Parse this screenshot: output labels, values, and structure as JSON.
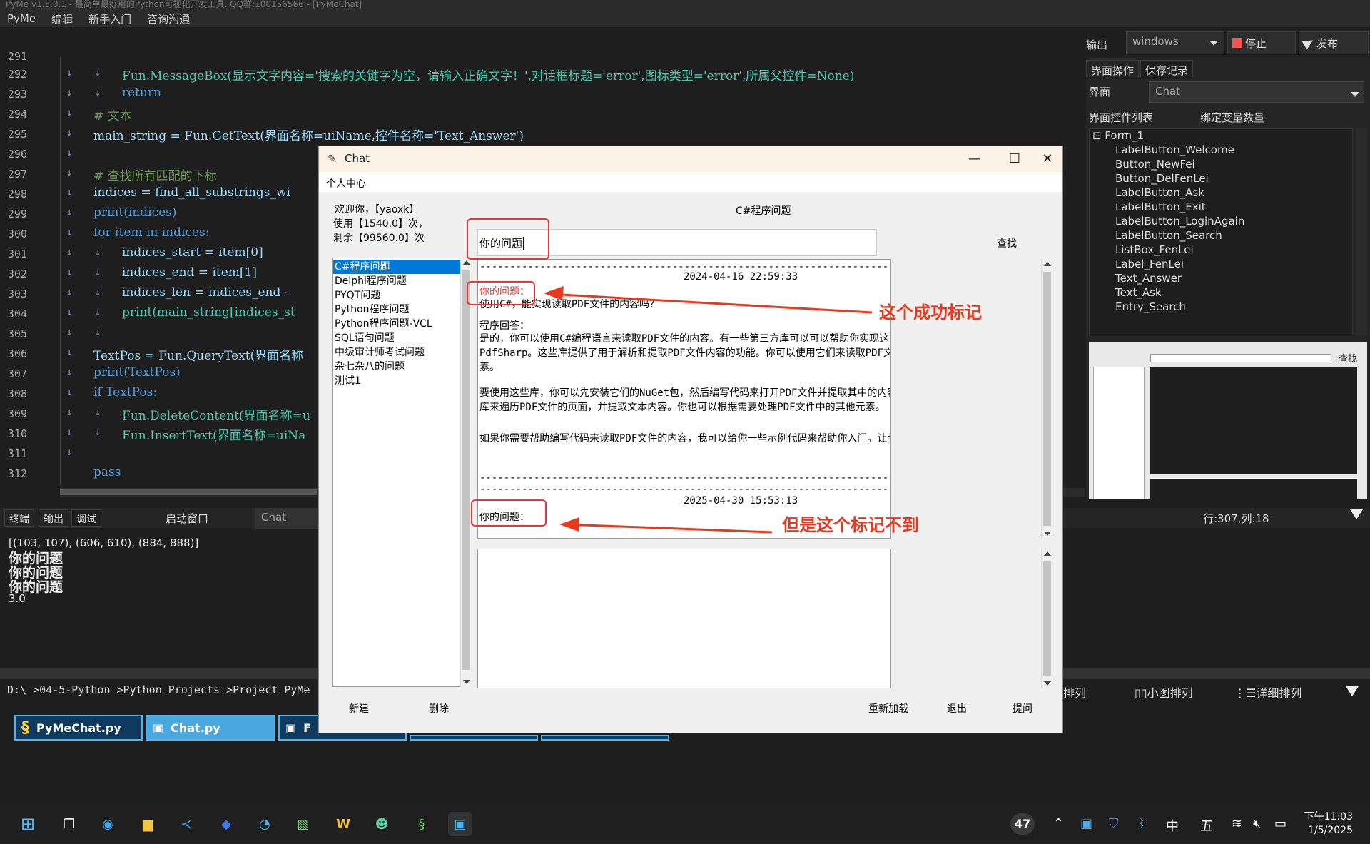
{
  "app": {
    "title": "PyMe v1.5.0.1 - 最简单最好用的Python可视化开发工具. QQ群:100156566 - [PyMeChat]"
  },
  "menu": [
    "PyMe",
    "编辑",
    "新手入门",
    "咨询沟通"
  ],
  "toolbar": {
    "output_label": "输出",
    "platform": "windows",
    "stop": "停止",
    "publish": "发布"
  },
  "code": {
    "lines": [
      {
        "n": "291",
        "text": ""
      },
      {
        "n": "292",
        "text": "Fun.MessageBox(显示文字内容='搜索的关键字为空，请输入正确文字！',对话框标题='error',图标类型='error',所属父控件=None)"
      },
      {
        "n": "293",
        "text": "return"
      },
      {
        "n": "294",
        "text": "# 文本"
      },
      {
        "n": "295",
        "text": "main_string = Fun.GetText(界面名称=uiName,控件名称='Text_Answer')"
      },
      {
        "n": "296",
        "text": ""
      },
      {
        "n": "297",
        "text": "# 查找所有匹配的下标"
      },
      {
        "n": "298",
        "text": "indices = find_all_substrings_wi"
      },
      {
        "n": "299",
        "text": "print(indices)"
      },
      {
        "n": "300",
        "text": "for item in indices:"
      },
      {
        "n": "301",
        "text": "indices_start = item[0]"
      },
      {
        "n": "302",
        "text": "indices_end = item[1]"
      },
      {
        "n": "303",
        "text": "indices_len = indices_end -"
      },
      {
        "n": "304",
        "text": "print(main_string[indices_st"
      },
      {
        "n": "305",
        "text": ""
      },
      {
        "n": "306",
        "text": "TextPos = Fun.QueryText(界面名称"
      },
      {
        "n": "307",
        "text": "print(TextPos)"
      },
      {
        "n": "308",
        "text": "if TextPos:"
      },
      {
        "n": "309",
        "text": "Fun.DeleteContent(界面名称=u"
      },
      {
        "n": "310",
        "text": "Fun.InsertText(界面名称=uiNa"
      },
      {
        "n": "311",
        "text": ""
      },
      {
        "n": "312",
        "text": "pass"
      }
    ]
  },
  "right_panel": {
    "tabs": [
      "界面操作",
      "保存记录"
    ],
    "ui_label": "界面",
    "ui_value": "Chat",
    "list_label": "界面控件列表",
    "bind_label": "绑定变量数量",
    "tree_root": "Form_1",
    "controls": [
      "LabelButton_Welcome",
      "Button_NewFei",
      "Button_DelFenLei",
      "LabelButton_Ask",
      "LabelButton_Exit",
      "LabelButton_LoginAgain",
      "LabelButton_Search",
      "ListBox_FenLei",
      "Label_FenLei",
      "Text_Answer",
      "Text_Ask",
      "Entry_Search"
    ],
    "preview_search": "查找"
  },
  "bottom": {
    "tabs": [
      "终端",
      "输出",
      "调试"
    ],
    "start_window": "启动窗口",
    "start_value": "Chat",
    "position": "行:307,列:18",
    "console": [
      "[(103, 107), (606, 610), (884, 888)]",
      "你的问题",
      "你的问题",
      "你的问题",
      "3.0"
    ],
    "path": "D:\\ >04-5-Python >Python_Projects >Project_PyMe",
    "view_options": [
      "排列",
      "小图排列",
      "详细排列"
    ],
    "file_tabs": [
      "PyMeChat.py",
      "Chat.py",
      "F"
    ]
  },
  "chat": {
    "title": "Chat",
    "menu": "个人中心",
    "welcome": "欢迎你，【yaoxk】",
    "used": "使用【1540.0】次，",
    "remaining": "剩余【99560.0】次",
    "category_label": "C#程序问题",
    "search_value": "你的问题",
    "search_button": "查找",
    "categories": [
      "C#程序问题",
      "Delphi程序问题",
      "PYQT问题",
      "Python程序问题",
      "Python程序问题-VCL",
      "SQL语句问题",
      "中级审计师考试问题",
      "杂七杂八的问题",
      "测试1"
    ],
    "answer": {
      "sep": "--------------------------------------------------------------------------------------",
      "time1": "2024-04-16 22:59:33",
      "q_label1": "你的问题：",
      "q1": "使用C#，能实现读取PDF文件的内容吗？",
      "a_label": "程序回答：",
      "p1": "是的，你可以使用C#编程语言来读取PDF文件的内容。有一些第三方库可以可以帮助你实现这个功能，比如iTextSharp和PdfSharp。这些库提供了用于解析和提取PDF文件内容的功能。你可以使用它们来读取PDF文件中的文本、图像和其他元素。",
      "p2": "要使用这些库，你可以先安装它们的NuGet包，然后编写代码来打开PDF文件并提取其中的内容。通常来说，你可以使用这些库来遍历PDF文件的页面，并提取文本内容。你也可以根据需要处理PDF文件中的其他元素。",
      "p3": "如果你需要帮助编写代码来读取PDF文件的内容，我可以给你一些示例代码来帮助你入门。让我知道你需要什么样的帮助！",
      "time2": "2025-04-30 15:53:13",
      "q_label2": "你的问题："
    },
    "buttons": [
      "新建",
      "删除",
      "重新加载",
      "退出",
      "提问"
    ]
  },
  "annotations": {
    "success": "这个成功标记",
    "fail": "但是这个标记不到"
  },
  "taskbar": {
    "weather_badge": "47",
    "ime1": "中",
    "ime2": "五",
    "time": "下午11:03",
    "date": "1/5/2025"
  },
  "colors": {
    "accent": "#0078d7",
    "annotation": "#e8391f",
    "editor_bg": "#1e1e1e"
  }
}
